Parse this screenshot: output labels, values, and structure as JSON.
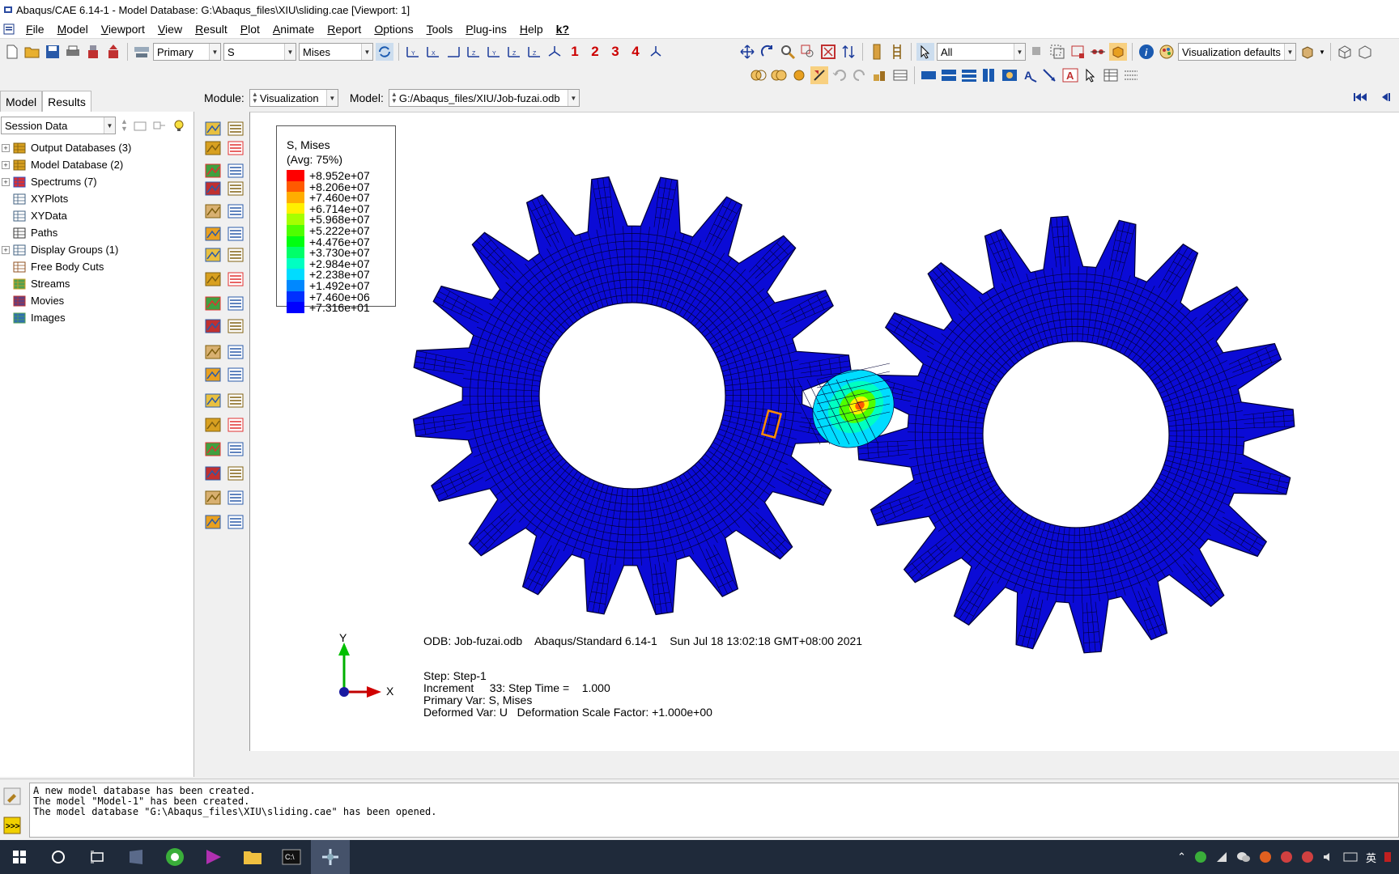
{
  "window": {
    "title": "Abaqus/CAE 6.14-1 - Model Database: G:\\Abaqus_files\\XIU\\sliding.cae [Viewport: 1]"
  },
  "menu": [
    "File",
    "Model",
    "Viewport",
    "View",
    "Result",
    "Plot",
    "Animate",
    "Report",
    "Options",
    "Tools",
    "Plug-ins",
    "Help",
    "k?"
  ],
  "toolbar": {
    "step_primary": "Primary",
    "field_var": "S",
    "invariant": "Mises",
    "viewport_numbers": [
      "1",
      "2",
      "3",
      "4"
    ],
    "selection_filter": "All",
    "visualization_defaults": "Visualization defaults"
  },
  "left_panel": {
    "tabs": [
      "Model",
      "Results"
    ],
    "active_tab": "Results",
    "session_select": "Session Data",
    "tree": [
      {
        "label": "Output Databases (3)",
        "expandable": true,
        "icon": "database-icon"
      },
      {
        "label": "Model Database (2)",
        "expandable": true,
        "icon": "database-icon"
      },
      {
        "label": "Spectrums (7)",
        "expandable": true,
        "icon": "spectrum-icon"
      },
      {
        "label": "XYPlots",
        "expandable": false,
        "icon": "grid-icon"
      },
      {
        "label": "XYData",
        "expandable": false,
        "icon": "grid-icon"
      },
      {
        "label": "Paths",
        "expandable": false,
        "icon": "path-icon"
      },
      {
        "label": "Display Groups (1)",
        "expandable": true,
        "icon": "display-group-icon"
      },
      {
        "label": "Free Body Cuts",
        "expandable": false,
        "icon": "free-body-icon"
      },
      {
        "label": "Streams",
        "expandable": false,
        "icon": "stream-icon"
      },
      {
        "label": "Movies",
        "expandable": false,
        "icon": "movie-icon"
      },
      {
        "label": "Images",
        "expandable": false,
        "icon": "image-icon"
      }
    ]
  },
  "module_row": {
    "module_label": "Module:",
    "module_value": "Visualization",
    "model_label": "Model:",
    "model_value": "G:/Abaqus_files/XIU/Job-fuzai.odb"
  },
  "legend": {
    "title_line1": "S, Mises",
    "title_line2": "(Avg: 75%)",
    "entries": [
      {
        "value": "+8.952e+07",
        "color": "#ff0000"
      },
      {
        "value": "+8.206e+07",
        "color": "#ff5a00"
      },
      {
        "value": "+7.460e+07",
        "color": "#ffad00"
      },
      {
        "value": "+6.714e+07",
        "color": "#fff000"
      },
      {
        "value": "+5.968e+07",
        "color": "#a6ff00"
      },
      {
        "value": "+5.222e+07",
        "color": "#4fff00"
      },
      {
        "value": "+4.476e+07",
        "color": "#00ff10"
      },
      {
        "value": "+3.730e+07",
        "color": "#00ff6a"
      },
      {
        "value": "+2.984e+07",
        "color": "#00ffc2"
      },
      {
        "value": "+2.238e+07",
        "color": "#00dcff"
      },
      {
        "value": "+1.492e+07",
        "color": "#0088ff"
      },
      {
        "value": "+7.460e+06",
        "color": "#0030ff"
      },
      {
        "value": "+7.316e+01",
        "color": "#0000ff"
      }
    ]
  },
  "viewport_info": {
    "odb_line": "ODB: Job-fuzai.odb    Abaqus/Standard 6.14-1    Sun Jul 18 13:02:18 GMT+08:00 2021",
    "step": "Step: Step-1",
    "increment": "Increment     33: Step Time =    1.000",
    "primary_var": "Primary Var: S, Mises",
    "deformed_var": "Deformed Var: U   Deformation Scale Factor: +1.000e+00",
    "axis_y": "Y",
    "axis_x": "X"
  },
  "messages": [
    "A new model database has been created.",
    "The model \"Model-1\" has been created.",
    "The model database \"G:\\Abaqus_files\\XIU\\sliding.cae\" has been opened."
  ],
  "tray": {
    "ime": "英"
  },
  "colors": {
    "gear_blue": "#0b0bd6",
    "mesh_line": "#000033",
    "taskbar": "#1f2a3a"
  }
}
